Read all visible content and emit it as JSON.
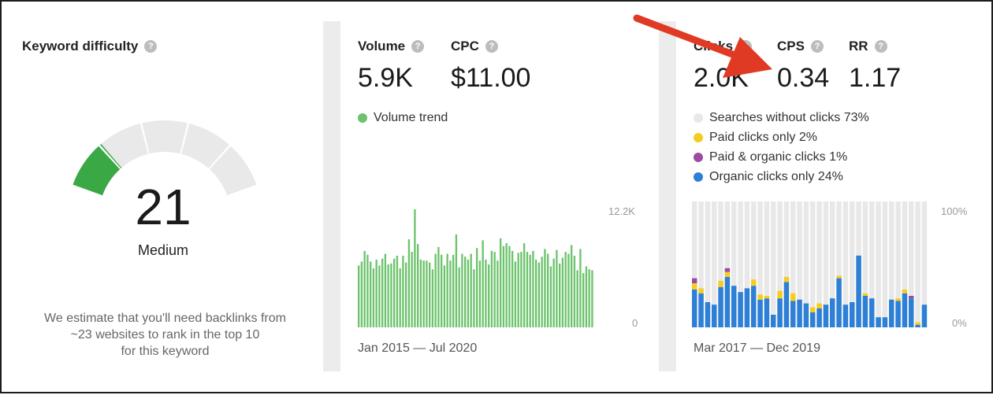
{
  "keyword_difficulty": {
    "title": "Keyword difficulty",
    "score": "21",
    "level": "Medium",
    "score_fraction": 0.21,
    "description_lines": [
      "We estimate that you'll need backlinks from",
      "~23 websites to rank in the top 10",
      "for this keyword"
    ],
    "gauge_color": "#3aa845",
    "gauge_track_color": "#e9e9e9"
  },
  "volume": {
    "label": "Volume",
    "value": "5.9K",
    "cpc_label": "CPC",
    "cpc_value": "$11.00",
    "legend": "Volume trend",
    "color": "#6cc36c",
    "axis_max_label": "12.2K",
    "axis_min_label": "0",
    "date_range": "Jan 2015 — Jul 2020",
    "chart_data": {
      "type": "bar",
      "ymax": 12.2,
      "values": [
        6.4,
        6.8,
        7.9,
        7.5,
        6.8,
        6.1,
        7.0,
        6.4,
        7.1,
        7.6,
        6.5,
        6.6,
        7.1,
        7.4,
        6.1,
        7.4,
        6.7,
        9.1,
        7.8,
        13.2,
        8.6,
        7.0,
        6.9,
        6.9,
        6.7,
        6.0,
        7.6,
        8.3,
        7.5,
        6.4,
        7.6,
        6.9,
        7.5,
        9.6,
        6.2,
        7.6,
        7.3,
        7.0,
        7.6,
        6.0,
        8.2,
        6.9,
        9.0,
        7.0,
        6.5,
        7.9,
        7.8,
        6.9,
        9.2,
        8.4,
        8.7,
        8.4,
        7.9,
        6.8,
        7.7,
        7.8,
        8.7,
        7.8,
        7.5,
        7.9,
        7.0,
        6.7,
        7.3,
        8.1,
        7.6,
        6.3,
        7.1,
        8.0,
        6.6,
        7.2,
        7.8,
        7.6,
        8.5,
        7.4,
        5.9,
        8.1,
        5.6,
        6.3,
        6.0,
        5.9
      ]
    }
  },
  "clicks": {
    "clicks_label": "Clicks",
    "clicks_value": "2.0K",
    "cps_label": "CPS",
    "cps_value": "0.34",
    "rr_label": "RR",
    "rr_value": "1.17",
    "legend": [
      {
        "label": "Searches without clicks 73%",
        "color": "#e8e8e8"
      },
      {
        "label": "Paid clicks only 2%",
        "color": "#f5cc1f"
      },
      {
        "label": "Paid & organic clicks 1%",
        "color": "#9b4ba5"
      },
      {
        "label": "Organic clicks only 24%",
        "color": "#2e7fd6"
      }
    ],
    "axis_max_label": "100%",
    "axis_min_label": "0%",
    "date_range": "Mar 2017 — Dec 2019",
    "chart_data": {
      "type": "bar",
      "stacked": true,
      "ymax": 100,
      "series": [
        {
          "name": "Organic clicks only",
          "color": "#2e7fd6",
          "values": [
            30,
            27,
            20,
            18,
            32,
            40,
            33,
            28,
            31,
            33,
            22,
            23,
            10,
            23,
            36,
            21,
            22,
            19,
            12,
            15,
            18,
            23,
            39,
            18,
            20,
            57,
            25,
            23,
            8,
            8,
            22,
            21,
            27,
            23,
            2,
            18
          ]
        },
        {
          "name": "Paid clicks only",
          "color": "#f5cc1f",
          "values": [
            5,
            4,
            0,
            0,
            5,
            4,
            0,
            0,
            0,
            5,
            4,
            2,
            0,
            6,
            4,
            6,
            0,
            0,
            4,
            4,
            0,
            0,
            2,
            0,
            0,
            0,
            2,
            0,
            0,
            0,
            0,
            2,
            3,
            0,
            2,
            0
          ]
        },
        {
          "name": "Paid & organic clicks",
          "color": "#9b4ba5",
          "values": [
            4,
            0,
            0,
            0,
            0,
            3,
            0,
            0,
            0,
            0,
            0,
            0,
            0,
            0,
            0,
            0,
            0,
            0,
            0,
            0,
            0,
            0,
            0,
            0,
            0,
            0,
            0,
            0,
            0,
            0,
            0,
            0,
            0,
            2,
            0,
            0
          ]
        }
      ]
    }
  },
  "annotation_arrow_color": "#e03a24"
}
